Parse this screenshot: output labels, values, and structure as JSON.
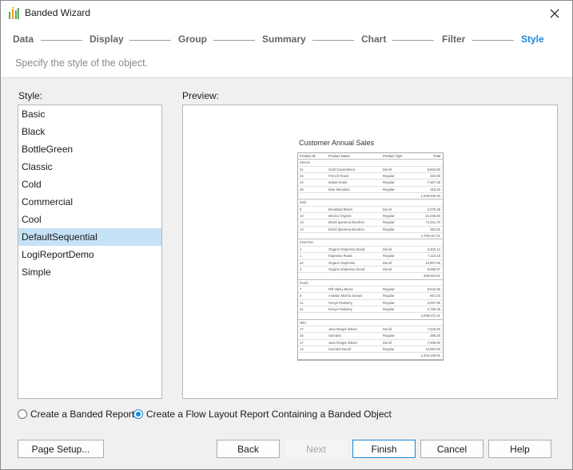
{
  "window": {
    "title": "Banded Wizard",
    "close_icon": "close-icon",
    "app_icon": "banded-wizard-icon"
  },
  "steps": [
    {
      "label": "Data"
    },
    {
      "label": "Display"
    },
    {
      "label": "Group"
    },
    {
      "label": "Summary"
    },
    {
      "label": "Chart"
    },
    {
      "label": "Filter"
    },
    {
      "label": "Style",
      "active": true
    }
  ],
  "subtitle": "Specify the style of the object.",
  "style_panel": {
    "label": "Style:",
    "items": [
      "Basic",
      "Black",
      "BottleGreen",
      "Classic",
      "Cold",
      "Commercial",
      "Cool",
      "DefaultSequential",
      "LogiReportDemo",
      "Simple"
    ],
    "selected": "DefaultSequential"
  },
  "preview": {
    "label": "Preview:",
    "report": {
      "title": "Customer Annual Sales",
      "columns": [
        "Product ID",
        "Product Name",
        "Product Type",
        "Total"
      ],
      "groups": [
        {
          "name": "Blends",
          "rows": [
            [
              "21",
              "Gold Coast Blend",
              "Decaf",
              "8,553.60"
            ],
            [
              "23",
              "French Roast",
              "Regular",
              "323.95"
            ],
            [
              "24",
              "Italian Roast",
              "Regular",
              "7,367.25"
            ],
            [
              "28",
              "Blue Mountain",
              "Regular",
              "316.40"
            ]
          ],
          "total": "1,839,509.43"
        },
        {
          "name": "Bold",
          "rows": [
            [
              "8",
              "Breakfast Blend",
              "Decaf",
              "2,078.36"
            ],
            [
              "10",
              "Mexico Organic",
              "Regular",
              "21,035.60"
            ],
            [
              "13",
              "Brazil Ipanema Bourbon",
              "Regular",
              "74,151.70"
            ],
            [
              "13",
              "Brazil Ipanema Bourbon",
              "Regular",
              "384.61"
            ]
          ],
          "total": "1,799,017.01"
        },
        {
          "name": "Espresso",
          "rows": [
            [
              "4",
              "Organic Espresso Decaf",
              "Decaf",
              "3,402.12"
            ],
            [
              "1",
              "Espresso Roast",
              "Regular",
              "7,110.16"
            ],
            [
              "22",
              "Organic Espresso",
              "Decaf",
              "10,907.65"
            ],
            [
              "4",
              "Organic Espresso Decaf",
              "Decaf",
              "8,599.97"
            ]
          ],
          "total": "465,664.61"
        },
        {
          "name": "Exotic",
          "rows": [
            [
              "7",
              "Rift Valley Blend",
              "Regular",
              "9,542.65"
            ],
            [
              "5",
              "Arabian Mocha Sanani",
              "Regular",
              "661.03"
            ],
            [
              "21",
              "Kenya Peaberry",
              "Regular",
              "2,597.95"
            ],
            [
              "21",
              "Kenya Peaberry",
              "Regular",
              "2,790.39"
            ]
          ],
          "total": "2,098,372.41"
        },
        {
          "name": "Mild",
          "rows": [
            [
              "17",
              "Java Dragon Blend",
              "Decaf",
              "7,526.60"
            ],
            [
              "15",
              "Sumatra",
              "Regular",
              "288.20"
            ],
            [
              "17",
              "Java Dragon Blend",
              "Decaf",
              "7,505.60"
            ],
            [
              "14",
              "Sumatra Decaf",
              "Regular",
              "12,884.94"
            ]
          ],
          "total": "2,334,229.91"
        }
      ]
    }
  },
  "options": {
    "banded_report": {
      "label": "Create a Banded Report",
      "checked": false
    },
    "flow_layout": {
      "label": "Create a Flow Layout Report Containing a Banded Object",
      "checked": true
    }
  },
  "buttons": {
    "page_setup": "Page Setup...",
    "back": "Back",
    "next": "Next",
    "finish": "Finish",
    "cancel": "Cancel",
    "help": "Help"
  },
  "colors": {
    "accent": "#1e88d6",
    "selection": "#c5e2f6"
  }
}
